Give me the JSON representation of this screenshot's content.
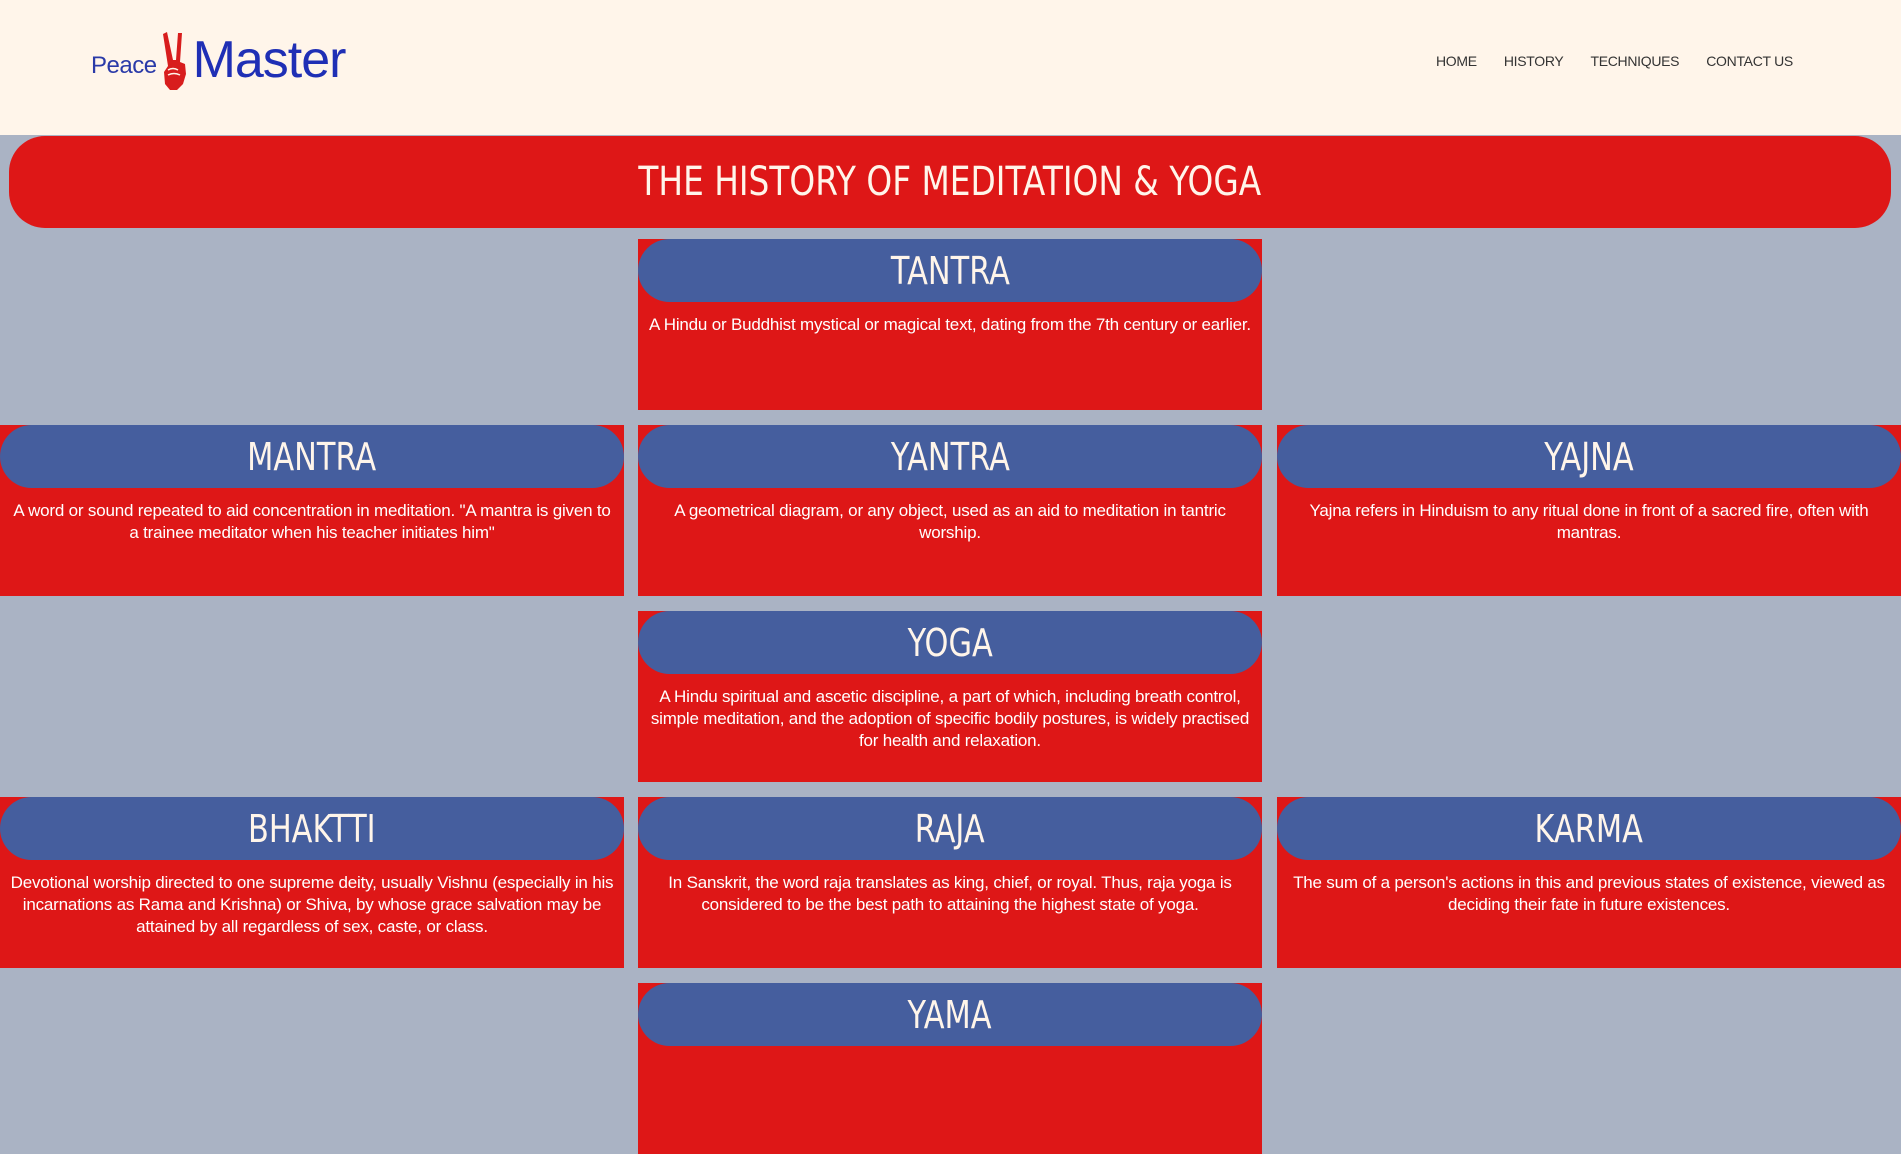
{
  "logo": {
    "small_text": "Peace",
    "big_text": "Master",
    "hand_icon": "peace-hand-icon",
    "hand_color": "#d81d1d",
    "text_color": "#1f2fb5"
  },
  "nav": {
    "items": [
      {
        "label": "HOME"
      },
      {
        "label": "HISTORY"
      },
      {
        "label": "TECHNIQUES"
      },
      {
        "label": "CONTACT US"
      }
    ]
  },
  "page": {
    "title": "THE HISTORY OF MEDITATION & YOGA"
  },
  "colors": {
    "header_bg": "#fff5ea",
    "page_bg": "#aab3c4",
    "card_red": "#de1717",
    "card_head_blue": "#455e9e"
  },
  "cards": {
    "tantra": {
      "title": "TANTRA",
      "text": "A Hindu or Buddhist mystical or magical text, dating from the 7th century or earlier."
    },
    "mantra": {
      "title": "MANTRA",
      "text": "A word or sound repeated to aid concentration in meditation. \"A mantra is given to a trainee meditator when his teacher initiates him\""
    },
    "yantra": {
      "title": "YANTRA",
      "text": "A geometrical diagram, or any object, used as an aid to meditation in tantric worship."
    },
    "yajna": {
      "title": "YAJNA",
      "text": "Yajna refers in Hinduism to any ritual done in front of a sacred fire, often with mantras."
    },
    "yoga": {
      "title": "YOGA",
      "text": "A Hindu spiritual and ascetic discipline, a part of which, including breath control, simple meditation, and the adoption of specific bodily postures, is widely practised for health and relaxation."
    },
    "bhaktti": {
      "title": "BHAKTTI",
      "text": "Devotional worship directed to one supreme deity, usually Vishnu (especially in his incarnations as Rama and Krishna) or Shiva, by whose grace salvation may be attained by all regardless of sex, caste, or class."
    },
    "raja": {
      "title": "RAJA",
      "text": "In Sanskrit, the word raja translates as king, chief, or royal. Thus, raja yoga is considered to be the best path to attaining the highest state of yoga."
    },
    "karma": {
      "title": "KARMA",
      "text": "The sum of a person's actions in this and previous states of existence, viewed as deciding their fate in future existences."
    },
    "yama": {
      "title": "YAMA",
      "text": ""
    }
  }
}
